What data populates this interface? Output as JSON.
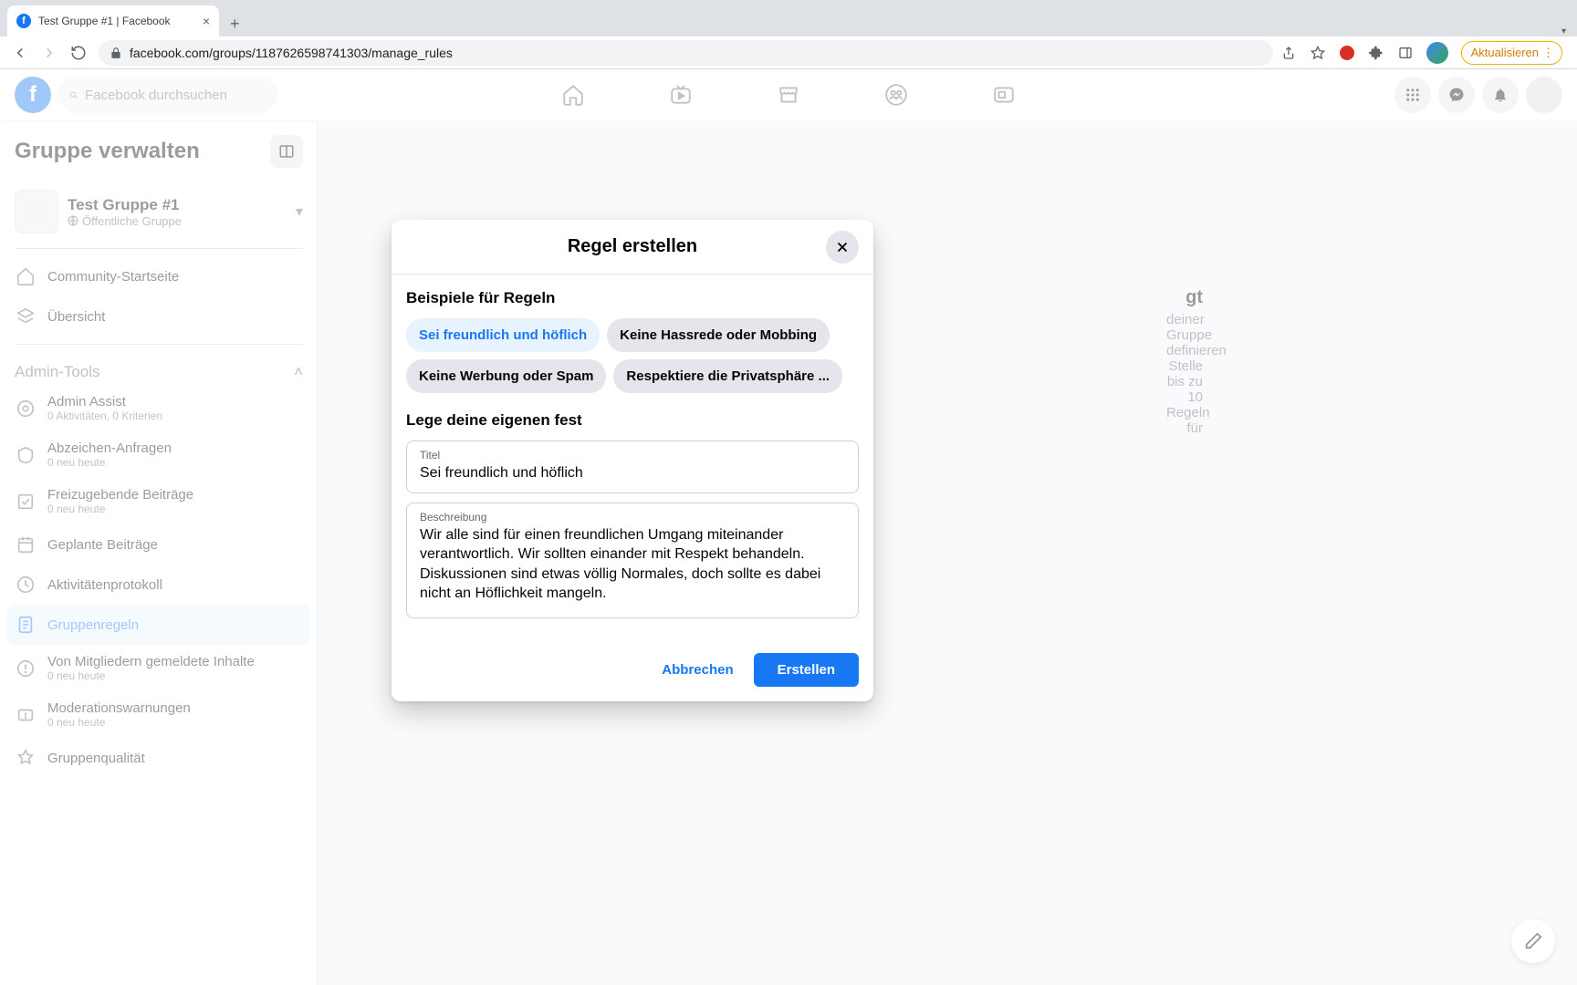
{
  "browser": {
    "tab_title": "Test Gruppe #1 | Facebook",
    "url": "facebook.com/groups/1187626598741303/manage_rules",
    "update_label": "Aktualisieren"
  },
  "fb_header": {
    "search_placeholder": "Facebook durchsuchen"
  },
  "sidebar": {
    "title": "Gruppe verwalten",
    "group_name": "Test Gruppe #1",
    "group_visibility": "Öffentliche Gruppe",
    "items_top": [
      {
        "label": "Community-Startseite"
      },
      {
        "label": "Übersicht"
      }
    ],
    "section_label": "Admin-Tools",
    "items": [
      {
        "label": "Admin Assist",
        "sub": "0 Aktivitäten, 0 Kriterien"
      },
      {
        "label": "Abzeichen-Anfragen",
        "sub": "0 neu heute"
      },
      {
        "label": "Freizugebende Beiträge",
        "sub": "0 neu heute"
      },
      {
        "label": "Geplante Beiträge"
      },
      {
        "label": "Aktivitätenprotokoll"
      },
      {
        "label": "Gruppenregeln"
      },
      {
        "label": "Von Mitgliedern gemeldete Inhalte",
        "sub": "0 neu heute"
      },
      {
        "label": "Moderationswarnungen",
        "sub": "0 neu heute"
      },
      {
        "label": "Gruppenqualität"
      }
    ]
  },
  "main": {
    "title_fragment": "gt",
    "line1": "deiner Gruppe definieren",
    "line2": "Stelle bis zu 10 Regeln für"
  },
  "modal": {
    "title": "Regel erstellen",
    "examples_heading": "Beispiele für Regeln",
    "chips": [
      "Sei freundlich und höflich",
      "Keine Hassrede oder Mobbing",
      "Keine Werbung oder Spam",
      "Respektiere die Privatsphäre ..."
    ],
    "own_heading": "Lege deine eigenen fest",
    "title_label": "Titel",
    "title_value": "Sei freundlich und höflich",
    "desc_label": "Beschreibung",
    "desc_value": "Wir alle sind für einen freundlichen Umgang miteinander verantwortlich. Wir sollten einander mit Respekt behandeln. Diskussionen sind etwas völlig Normales, doch sollte es dabei nicht an Höflichkeit mangeln.",
    "cancel": "Abbrechen",
    "create": "Erstellen"
  }
}
